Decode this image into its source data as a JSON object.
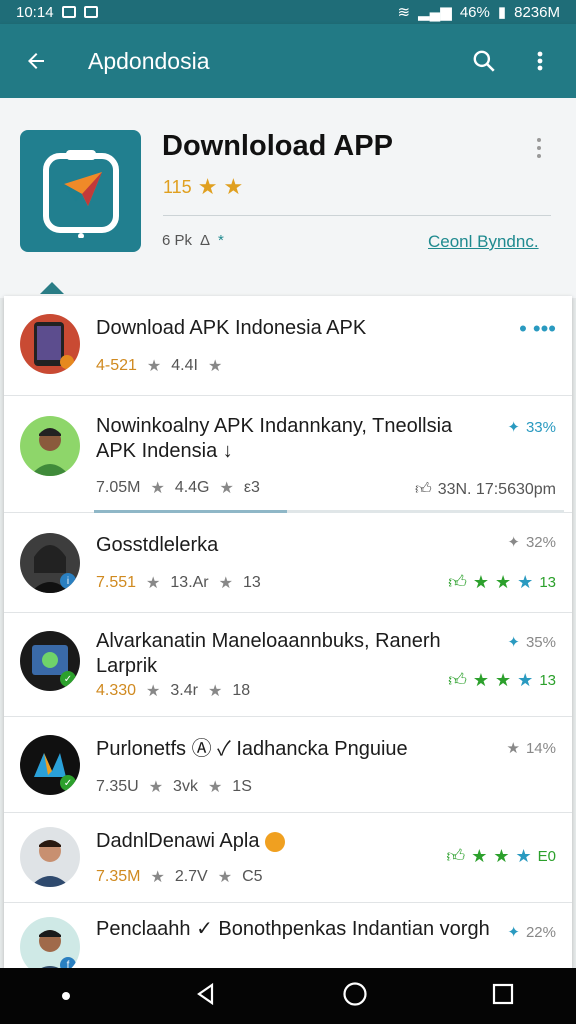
{
  "status": {
    "time": "10:14",
    "battery": "46%",
    "right_time": "8236M"
  },
  "appbar": {
    "title": "Apdondosia",
    "back_icon": "arrow-left-icon",
    "search_icon": "search-icon",
    "more_icon": "more-vert-icon"
  },
  "header": {
    "title": "Downloload APP",
    "rating_num": "115",
    "meta_left": "6 Pk",
    "meta_mid": "Δ",
    "meta_star": "*",
    "link": "Ceonl Byndnc."
  },
  "list": [
    {
      "title": "Download  APK Indonesia APK",
      "meta_num": "4-521",
      "meta_a": "4.4I",
      "right_extra": "• •••",
      "avatar": "phone"
    },
    {
      "title": "Nowinkoalny APK Indannkany, Tneollsia APK Indensia ↓",
      "meta_num": "7.05M",
      "meta_a": "4.4G",
      "meta_b": "ε3",
      "right_pct": "33%",
      "right_extra2": "33N. 17:5630pm",
      "avatar": "man-green",
      "progress": 0.41
    },
    {
      "title": "Gosstdlelerka",
      "meta_num": "7.551",
      "meta_a": "13.Ar",
      "meta_b": "13",
      "right_pct": "32%",
      "right_num": "13",
      "avatar": "woman-dark"
    },
    {
      "title": "Alvarkanatin Maneloaannbuks, Ranerh Larprik",
      "meta_num": "4.330",
      "meta_a": "3.4r",
      "meta_b": "18",
      "right_pct": "35%",
      "right_num": "13",
      "avatar": "tablet"
    },
    {
      "title": "Purlonetfs Ⓐ ✓ Iadhancka Pnguiue",
      "meta_num": "7.35U",
      "meta_a": "3vk",
      "meta_b": "1S",
      "right_pct": "14%",
      "avatar": "logo-dark"
    },
    {
      "title": "DadnlDenawi Apla",
      "meta_num": "7.35M",
      "meta_a": "2.7V",
      "meta_b": "C5",
      "right_num": "E0",
      "avatar": "man-suit"
    },
    {
      "title": "Penclaahh ✓ Bonothpenkas Indantian vorgh",
      "meta_num": "",
      "meta_a": "",
      "meta_b": "",
      "right_pct": "22%",
      "avatar": "man-teal"
    }
  ]
}
